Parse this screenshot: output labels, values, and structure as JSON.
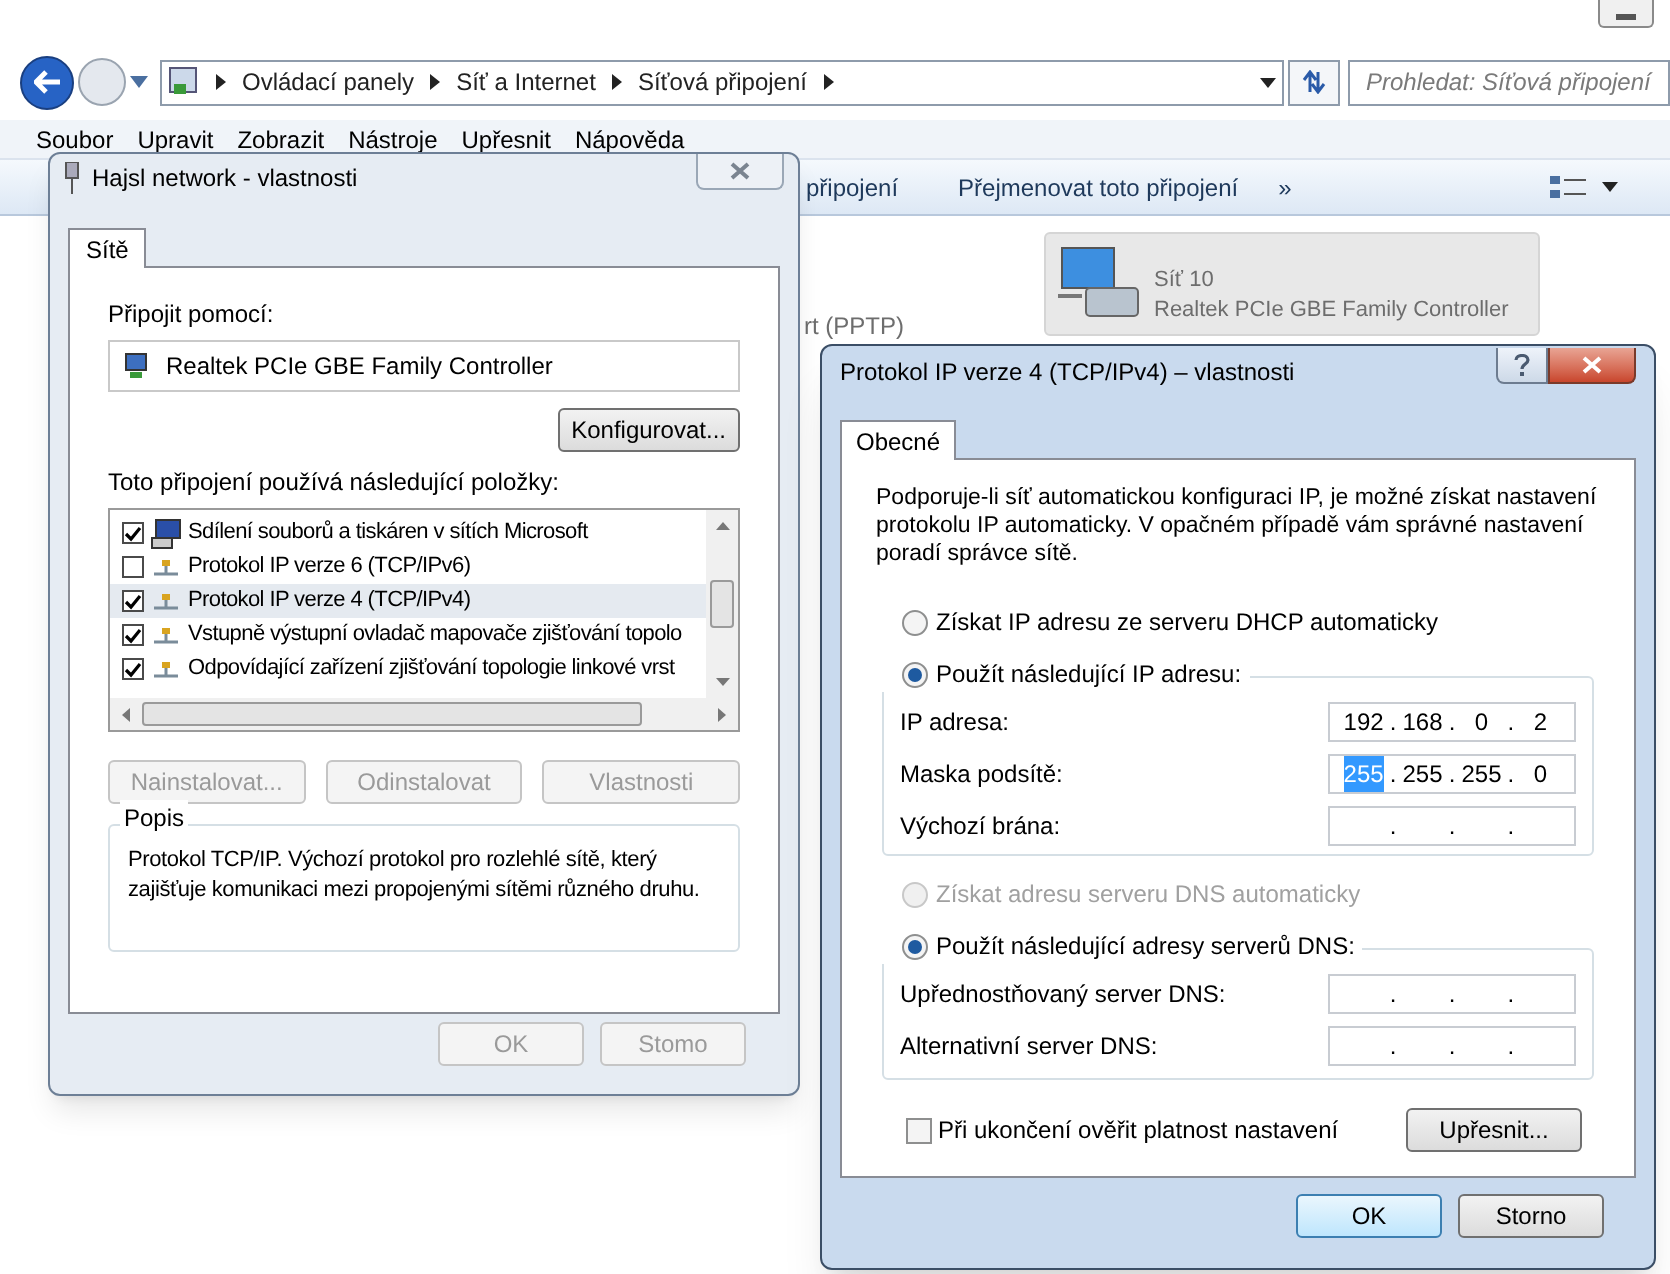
{
  "explorer": {
    "breadcrumbs": [
      "Ovládací panely",
      "Síť a Internet",
      "Síťová připojení"
    ],
    "search": {
      "placeholder": "Prohledat: Síťová připojení"
    },
    "menu": [
      "Soubor",
      "Upravit",
      "Zobrazit",
      "Nástroje",
      "Upřesnit",
      "Nápověda"
    ],
    "toolbar": [
      "připojení",
      "Přejmenovat toto připojení",
      "»"
    ],
    "partial_label": "rt (PPTP)",
    "connection": {
      "name": "Síť 10",
      "device": "Realtek PCIe GBE Family Controller"
    }
  },
  "network_dialog": {
    "title": "Hajsl network - vlastnosti",
    "tabs": [
      {
        "label": "Sítě",
        "selected": true
      }
    ],
    "connect_using_label": "Připojit pomocí:",
    "adapter": "Realtek PCIe GBE Family Controller",
    "configure_button": "Konfigurovat...",
    "items_label": "Toto připojení používá následující položky:",
    "items": [
      {
        "kind": "share",
        "label": "Sdílení souborů a tiskáren v sítích Microsoft",
        "checked": true,
        "selected": false
      },
      {
        "kind": "protocol",
        "label": "Protokol IP verze 6 (TCP/IPv6)",
        "checked": false,
        "selected": false
      },
      {
        "kind": "protocol",
        "label": "Protokol IP verze 4 (TCP/IPv4)",
        "checked": true,
        "selected": true
      },
      {
        "kind": "protocol",
        "label": "Vstupně výstupní ovladač mapovače zjišťování topolo",
        "checked": true,
        "selected": false
      },
      {
        "kind": "protocol",
        "label": "Odpovídající zařízení zjišťování topologie linkové vrst",
        "checked": true,
        "selected": false
      }
    ],
    "buttons": [
      {
        "label": "Nainstalovat...",
        "disabled": true
      },
      {
        "label": "Odinstalovat",
        "disabled": true
      },
      {
        "label": "Vlastnosti",
        "disabled": true
      }
    ],
    "description": {
      "title": "Popis",
      "text": "Protokol TCP/IP. Výchozí protokol pro rozlehlé sítě, který zajišťuje komunikaci mezi propojenými sítěmi různého druhu."
    },
    "footer_buttons": [
      {
        "label": "OK",
        "disabled": true
      },
      {
        "label": "Stomo",
        "disabled": true
      }
    ]
  },
  "ipv4_dialog": {
    "title": "Protokol IP verze 4 (TCP/IPv4) – vlastnosti",
    "tabs": [
      {
        "label": "Obecné",
        "selected": true
      }
    ],
    "intro": "Podporuje-li síť automatickou konfiguraci IP, je možné získat nastavení protokolu IP automaticky. V opačném případě vám správné nastavení poradí správce sítě.",
    "dot": ".",
    "ip_options": [
      {
        "label": "Získat IP adresu ze serveru DHCP automaticky",
        "selected": false,
        "disabled": false
      },
      {
        "label": "Použít následující IP adresu:",
        "selected": true,
        "disabled": false
      }
    ],
    "ip_fields": [
      {
        "label": "IP adresa:",
        "octets": [
          {
            "value": "192",
            "selected": false
          },
          {
            "value": "168",
            "selected": false
          },
          {
            "value": "0",
            "selected": false
          },
          {
            "value": "2",
            "selected": false
          }
        ]
      },
      {
        "label": "Maska podsítě:",
        "octets": [
          {
            "value": "255",
            "selected": true
          },
          {
            "value": "255",
            "selected": false
          },
          {
            "value": "255",
            "selected": false
          },
          {
            "value": "0",
            "selected": false
          }
        ]
      },
      {
        "label": "Výchozí brána:"
      }
    ],
    "dns_options": [
      {
        "label": "Získat adresu serveru DNS automaticky",
        "selected": false,
        "disabled": true
      },
      {
        "label": "Použít následující adresy serverů DNS:",
        "selected": true,
        "disabled": false
      }
    ],
    "dns_fields": [
      {
        "label": "Upřednostňovaný server DNS:"
      },
      {
        "label": "Alternativní server DNS:"
      }
    ],
    "validate_checkbox": {
      "label": "Při ukončení ověřit platnost nastavení",
      "checked": false
    },
    "advanced_button": "Upřesnit...",
    "footer_buttons": [
      {
        "label": "OK",
        "default": true
      },
      {
        "label": "Storno",
        "default": false
      }
    ]
  }
}
